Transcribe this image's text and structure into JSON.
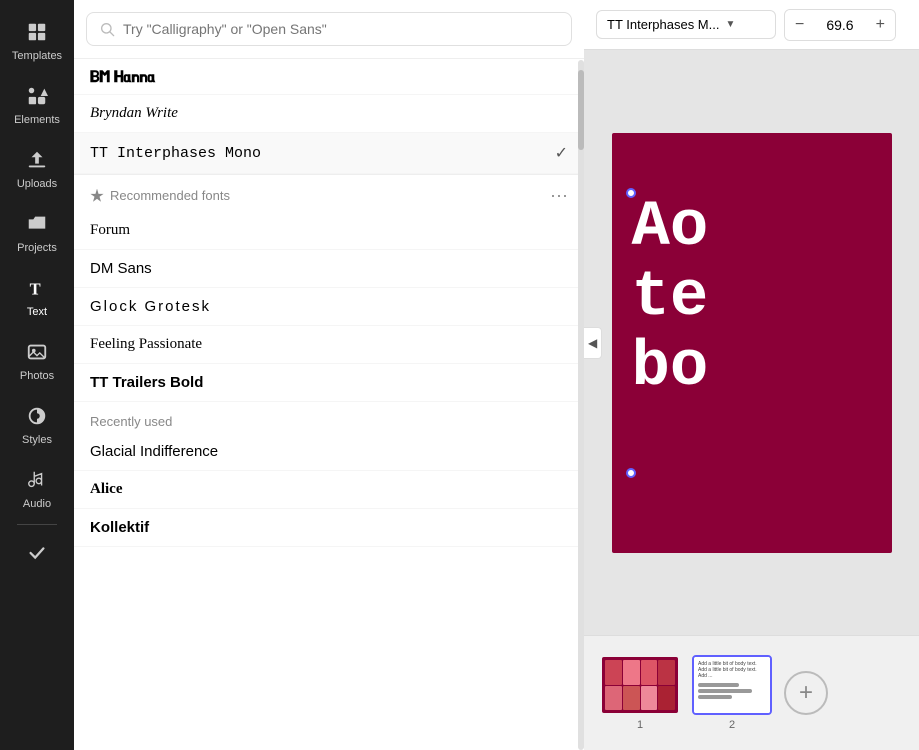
{
  "sidebar": {
    "items": [
      {
        "id": "templates",
        "label": "Templates",
        "icon": "grid"
      },
      {
        "id": "elements",
        "label": "Elements",
        "icon": "shapes"
      },
      {
        "id": "uploads",
        "label": "Uploads",
        "icon": "upload"
      },
      {
        "id": "projects",
        "label": "Projects",
        "icon": "folder"
      },
      {
        "id": "text",
        "label": "Text",
        "icon": "text"
      },
      {
        "id": "photos",
        "label": "Photos",
        "icon": "image"
      },
      {
        "id": "styles",
        "label": "Styles",
        "icon": "palette"
      },
      {
        "id": "audio",
        "label": "Audio",
        "icon": "music"
      }
    ]
  },
  "font_panel": {
    "search": {
      "placeholder": "Try \"Calligraphy\" or \"Open Sans\""
    },
    "pinned_fonts": [
      {
        "name": "BM Hanna",
        "style_class": "font-bm-hanna",
        "selected": false
      },
      {
        "name": "Bryndan Write",
        "style_class": "font-bryndan",
        "selected": false
      },
      {
        "name": "TT Interphases Mono",
        "style_class": "font-tt-interphases",
        "selected": true
      }
    ],
    "recommended_section": {
      "label": "Recommended fonts"
    },
    "recommended_fonts": [
      {
        "name": "Forum",
        "style_class": "font-forum"
      },
      {
        "name": "DM Sans",
        "style_class": "font-dm-sans"
      },
      {
        "name": "Glock Grotesk",
        "style_class": "font-glock"
      },
      {
        "name": "Feeling Passionate",
        "style_class": "font-feeling"
      },
      {
        "name": "TT Trailers Bold",
        "style_class": "font-tt-trailers"
      }
    ],
    "recently_used_section": {
      "label": "Recently used"
    },
    "recent_fonts": [
      {
        "name": "Glacial Indifference",
        "style_class": "font-glacial"
      },
      {
        "name": "Alice",
        "style_class": "font-alice"
      },
      {
        "name": "Kollektif",
        "style_class": "font-kollektif"
      }
    ]
  },
  "toolbar": {
    "font_name": "TT Interphases M...",
    "font_size": "69.6",
    "decrease_label": "−",
    "increase_label": "+"
  },
  "canvas": {
    "text_preview": "Ao\nte\nbo"
  },
  "filmstrip": {
    "slides": [
      {
        "number": "1"
      },
      {
        "number": "2",
        "active": true
      }
    ],
    "add_label": "+"
  }
}
